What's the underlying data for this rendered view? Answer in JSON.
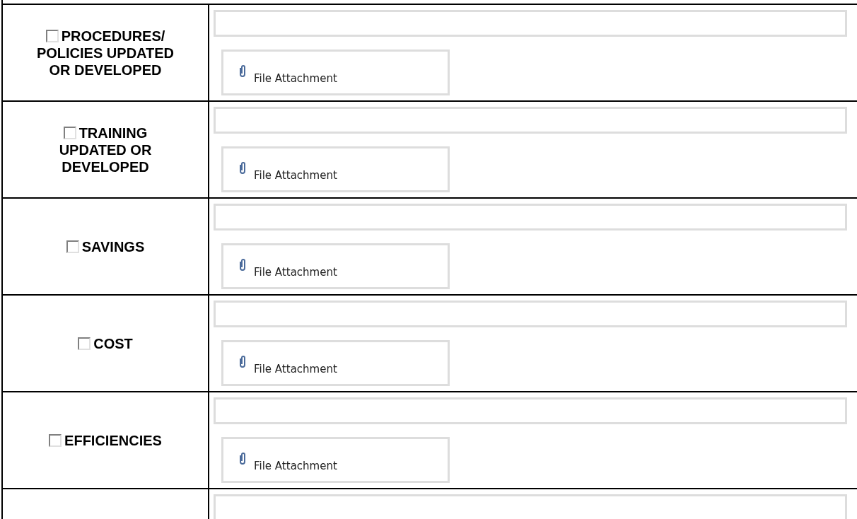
{
  "rows": [
    {
      "kind": "item",
      "label_lines": [
        "PROCEDURES/",
        "POLICIES UPDATED",
        "OR DEVELOPED"
      ],
      "checked": false,
      "attachment": "File Attachment"
    },
    {
      "kind": "item",
      "label_lines": [
        "TRAINING",
        "UPDATED OR",
        "DEVELOPED"
      ],
      "checked": false,
      "attachment": "File Attachment"
    },
    {
      "kind": "item",
      "label_lines": [
        "SAVINGS"
      ],
      "checked": false,
      "attachment": "File Attachment"
    },
    {
      "kind": "item",
      "label_lines": [
        "COST"
      ],
      "checked": false,
      "attachment": "File Attachment"
    },
    {
      "kind": "item",
      "label_lines": [
        "EFFICIENCIES"
      ],
      "checked": false,
      "attachment": "File Attachment"
    },
    {
      "kind": "cut_off"
    }
  ]
}
